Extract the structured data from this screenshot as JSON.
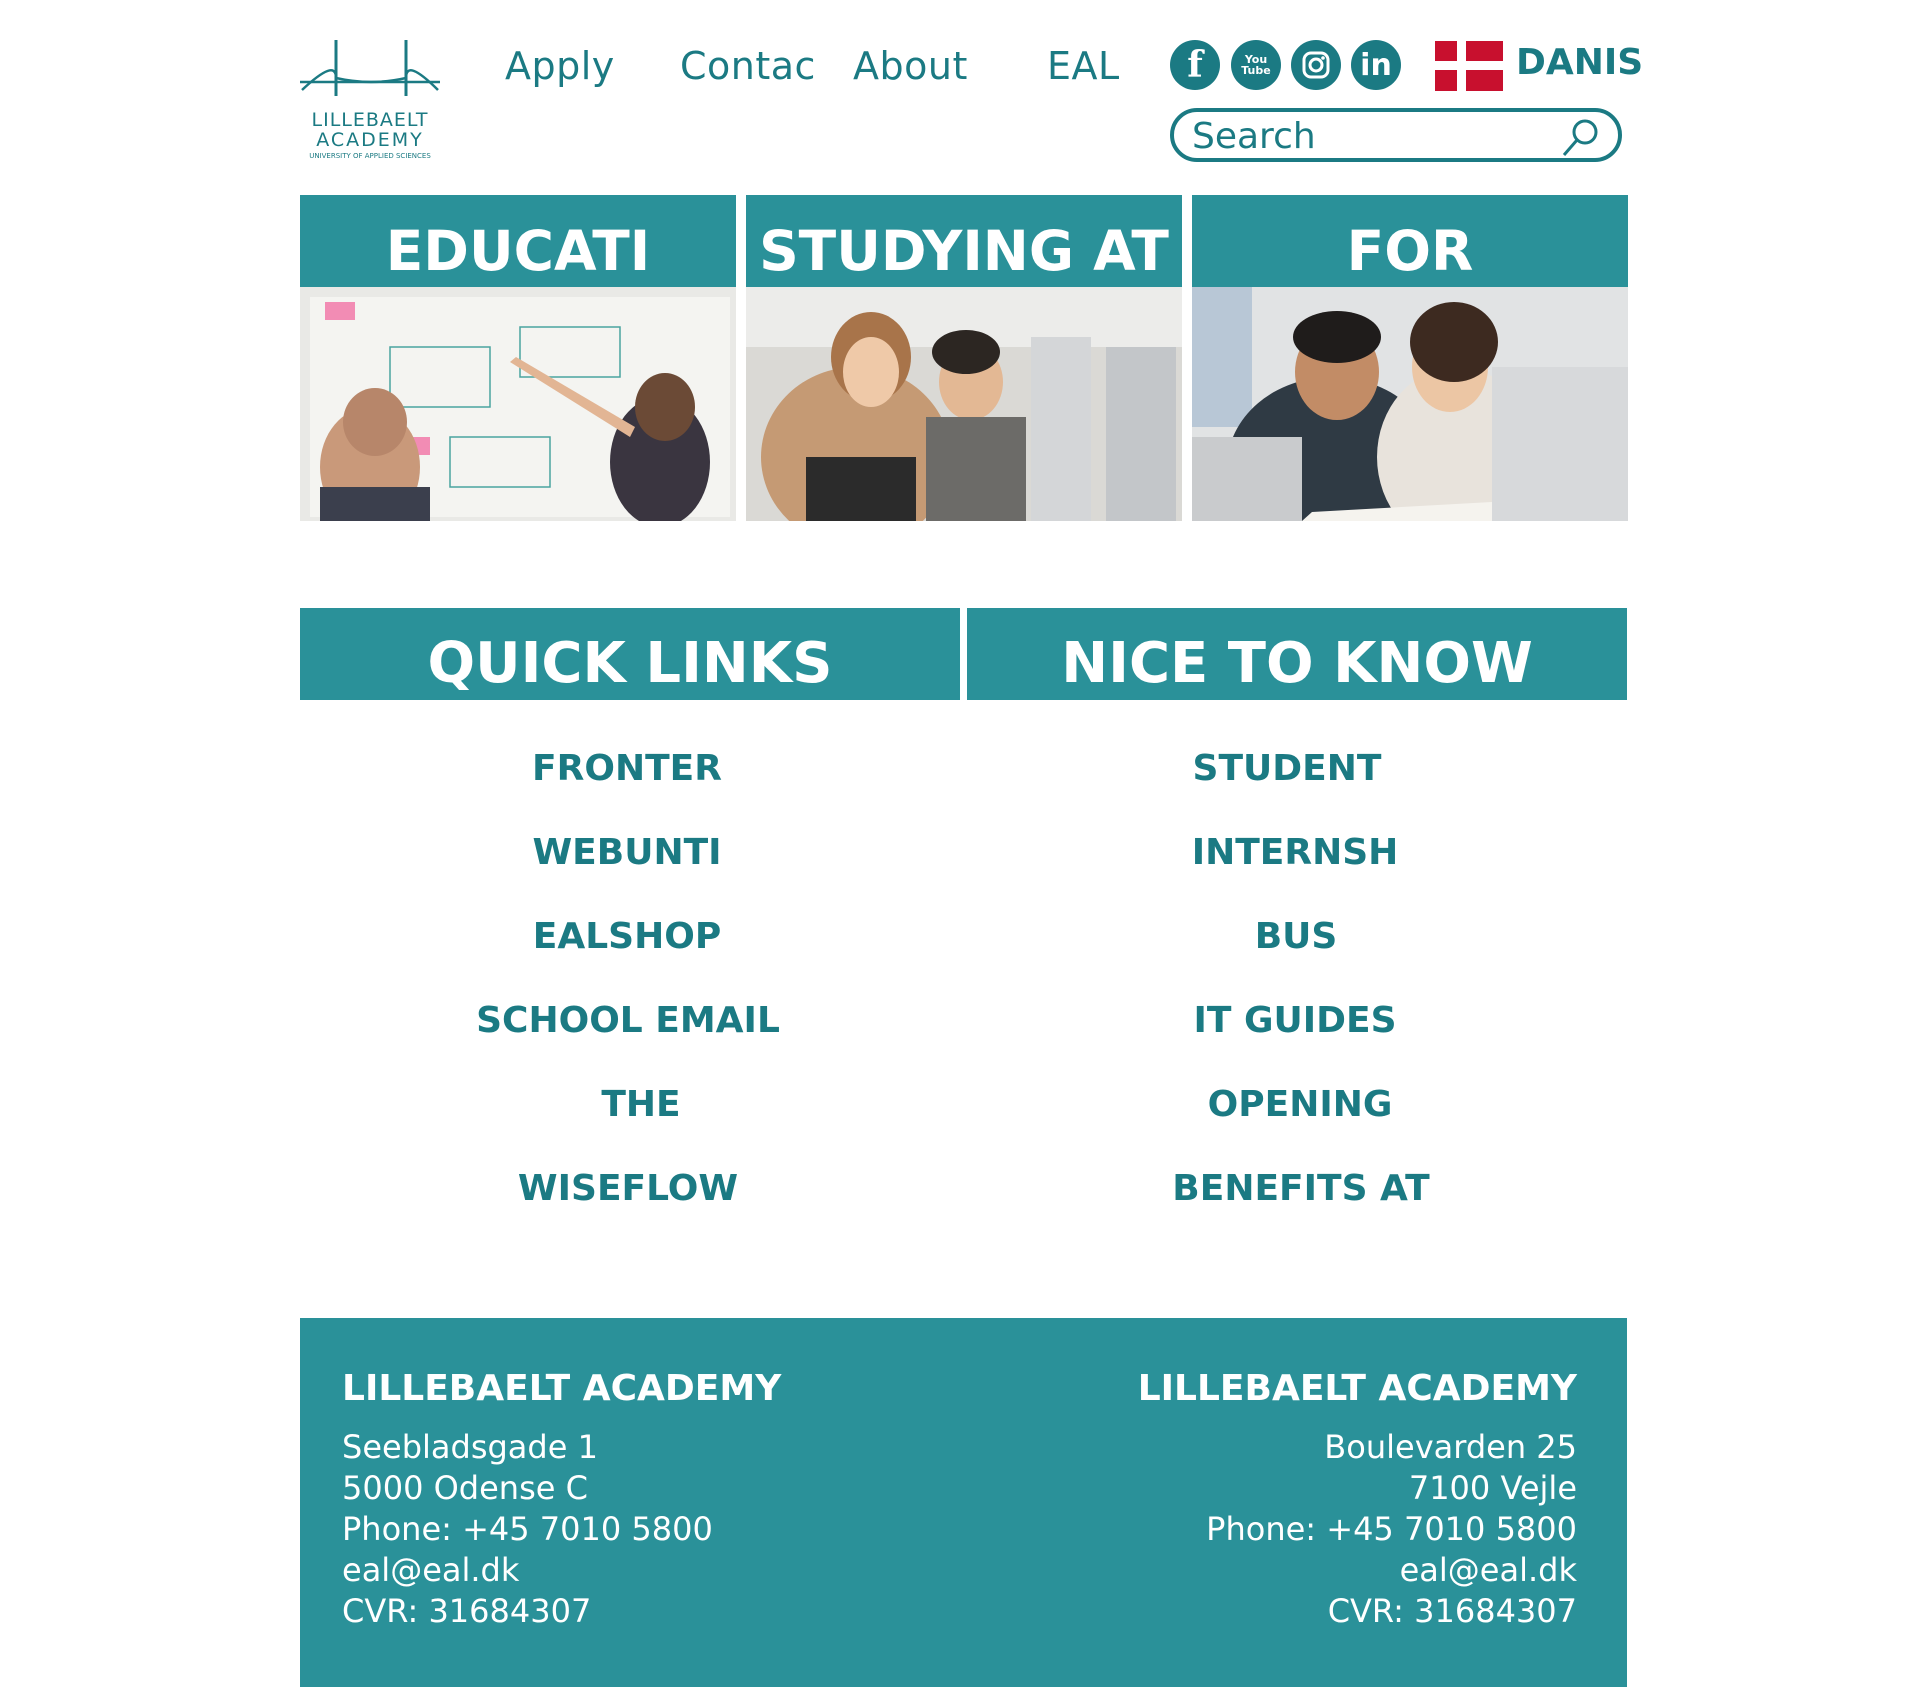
{
  "brand": {
    "logo_line1": "LILLEBAELT",
    "logo_line2": "ACADEMY",
    "logo_line3": "UNIVERSITY OF APPLIED SCIENCES",
    "color": "#1b7a83",
    "accent": "#2a9199"
  },
  "nav": {
    "items": [
      "Apply",
      "Contac",
      "About",
      "EAL"
    ]
  },
  "social": {
    "icons": [
      "facebook-icon",
      "youtube-icon",
      "instagram-icon",
      "linkedin-icon"
    ],
    "labels": [
      "f",
      "You Tube",
      "",
      "in"
    ]
  },
  "language": {
    "label": "DANIS"
  },
  "search": {
    "placeholder": "Search"
  },
  "cards": [
    {
      "title": "EDUCATI"
    },
    {
      "title": "STUDYING AT"
    },
    {
      "title": "FOR"
    }
  ],
  "quick_links": {
    "heading": "QUICK LINKS",
    "items": [
      "FRONTER",
      "WEBUNTI",
      "EALSHOP",
      "SCHOOL EMAIL",
      "THE",
      "WISEFLOW"
    ]
  },
  "nice_to_know": {
    "heading": "NICE TO KNOW",
    "items": [
      "STUDENT",
      "INTERNSH",
      "BUS",
      "IT GUIDES",
      "OPENING",
      "BENEFITS AT"
    ]
  },
  "footer": {
    "left": {
      "title": "LILLEBAELT ACADEMY",
      "lines": [
        "Seebladsgade 1",
        "5000 Odense C",
        "Phone: +45 7010 5800",
        "eal@eal.dk",
        "CVR: 31684307"
      ]
    },
    "right": {
      "title": "LILLEBAELT ACADEMY",
      "lines": [
        "Boulevarden 25",
        "7100 Vejle",
        "Phone: +45 7010 5800",
        "eal@eal.dk",
        "CVR: 31684307"
      ]
    }
  }
}
